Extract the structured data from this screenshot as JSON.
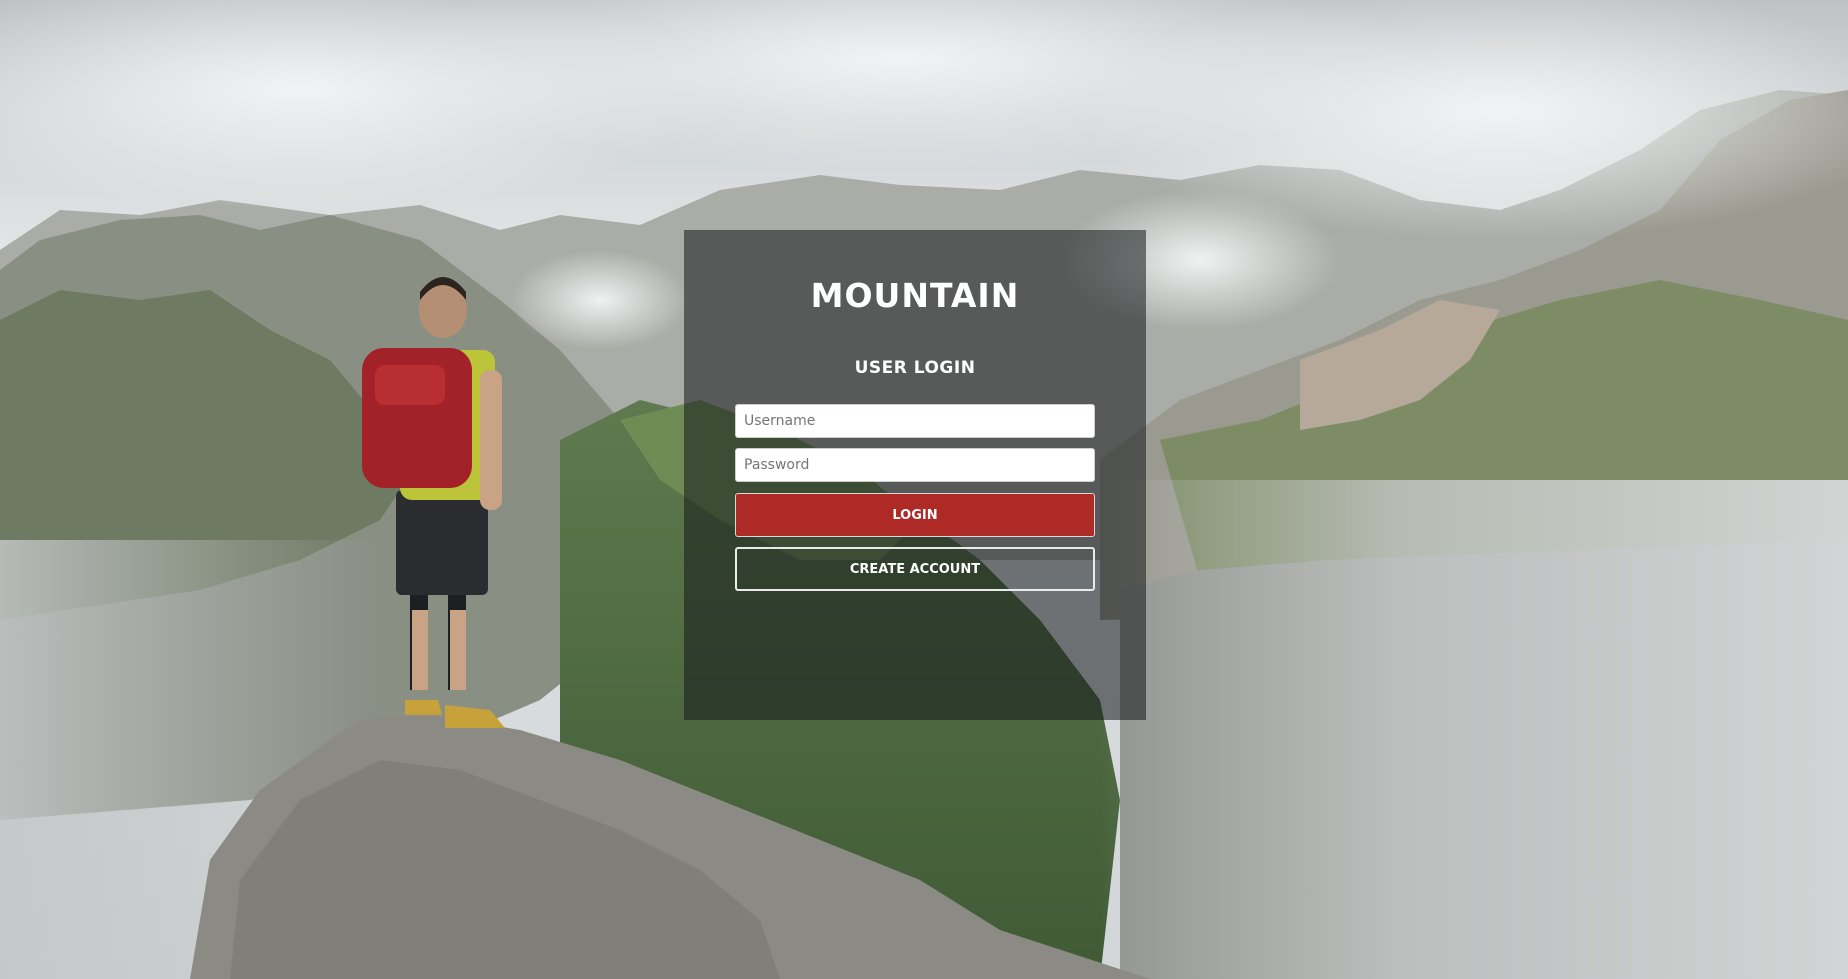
{
  "brand": {
    "title": "MOUNTAIN"
  },
  "login_form": {
    "heading": "USER LOGIN",
    "username": {
      "placeholder": "Username",
      "value": ""
    },
    "password": {
      "placeholder": "Password",
      "value": ""
    },
    "login_button_label": "LOGIN",
    "create_account_label": "CREATE ACCOUNT"
  },
  "colors": {
    "login_button": "#ad2a27",
    "panel_overlay": "rgba(20,24,26,0.55)",
    "text": "#ffffff"
  },
  "background": {
    "description_icon": "mountain-hiker-background"
  }
}
